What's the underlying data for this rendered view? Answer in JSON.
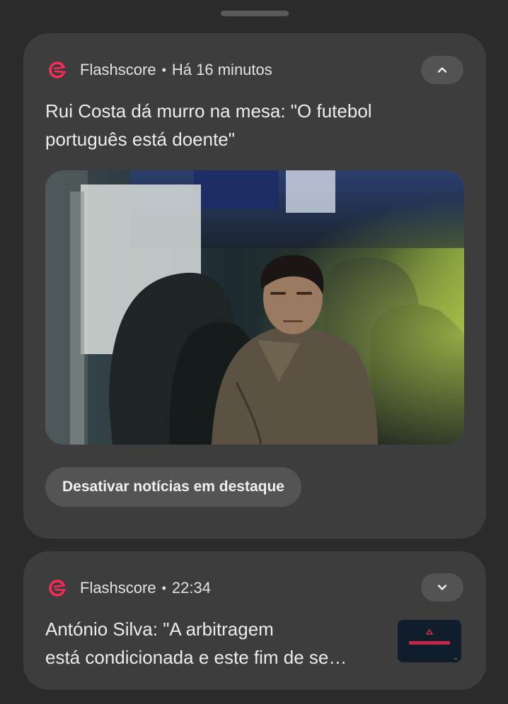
{
  "notifications": [
    {
      "app_name": "Flashscore",
      "separator": "•",
      "time": "Há 16 minutos",
      "headline_lines": [
        "Rui Costa dá murro na mesa: \"O futebol",
        "português está doente\""
      ],
      "expand_icon": "chevron-up-icon",
      "image": "photo-man-in-stadium-seat",
      "action_label": "Desativar notícias em destaque"
    },
    {
      "app_name": "Flashscore",
      "separator": "•",
      "time": "22:34",
      "headline_lines": [
        "António Silva: \"A arbitragem",
        "está condicionada e este fim de se…"
      ],
      "expand_icon": "chevron-down-icon",
      "image": "thumbnail-flashscore"
    }
  ],
  "colors": {
    "background": "#2b2b2b",
    "card": "#3d3d3d",
    "button": "#545454",
    "brand": "#ff2b56"
  }
}
